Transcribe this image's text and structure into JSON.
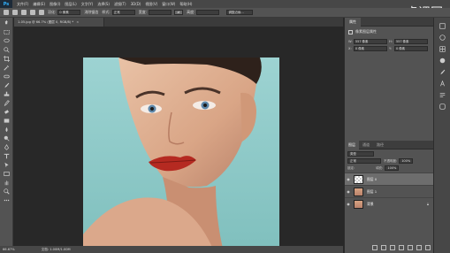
{
  "menubar": {
    "logo": "Ps",
    "items": [
      "文件(F)",
      "编辑(E)",
      "图像(I)",
      "图层(L)",
      "文字(Y)",
      "选择(S)",
      "滤镜(T)",
      "3D(D)",
      "视图(V)",
      "窗口(W)",
      "帮助(H)"
    ],
    "watermark": "虎课网",
    "watermark_en": "HUKE88.COM"
  },
  "options": {
    "feather_label": "羽化:",
    "feather_value": "0 像素",
    "antialias_label": "消除锯齿",
    "style_label": "样式:",
    "style_value": "正常",
    "width_label": "宽度:",
    "height_label": "高度:",
    "refine_button": "调整边缘..."
  },
  "document": {
    "tab_title": "1-05.jpg @ 66.7% (图层 0, RGB/8) *",
    "tab_close": "×",
    "zoom": "66.67%",
    "info": "文档: 1.00M/1.00M"
  },
  "properties": {
    "tab": "属性",
    "subtitle": "像素图层属性",
    "w_label": "W:",
    "w_value": "557 像素",
    "h_label": "H:",
    "h_value": "557 像素",
    "x_label": "X:",
    "x_value": "0 像素",
    "y_label": "Y:",
    "y_value": "0 像素"
  },
  "layers": {
    "tabs": [
      "图层",
      "通道",
      "路径"
    ],
    "kind_value": "类型",
    "blend_mode": "正常",
    "opacity_label": "不透明度:",
    "opacity_value": "100%",
    "lock_label": "锁定:",
    "fill_label": "填充:",
    "fill_value": "100%",
    "items": [
      {
        "name": "图层 0",
        "selected": true,
        "thumb": "empty"
      },
      {
        "name": "图层 1",
        "selected": false,
        "thumb": "face"
      },
      {
        "name": "背景",
        "selected": false,
        "thumb": "face",
        "locked": true
      }
    ]
  },
  "colors": {
    "ps_blue": "#33b3ff",
    "selection": "#6d6d6d",
    "photo_background": "#8ec9c8"
  }
}
